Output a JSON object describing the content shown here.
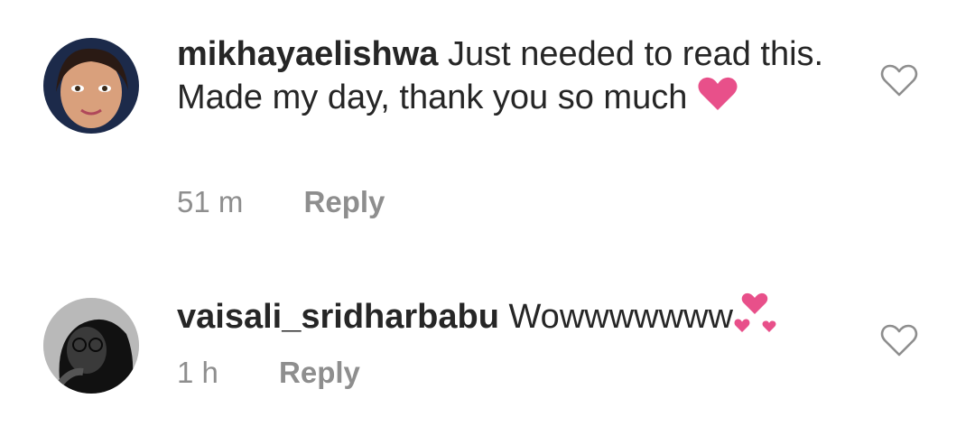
{
  "comments": [
    {
      "username": "mikhayaelishwa",
      "text": "Just needed to read this. Made my day, thank you so much",
      "emoji": "heart-icon",
      "time": "51 m",
      "reply_label": "Reply"
    },
    {
      "username": "vaisali_sridharbabu",
      "text": "Wowwwwwww",
      "emoji": "revolving-hearts-icon",
      "time": "1 h",
      "reply_label": "Reply"
    }
  ],
  "colors": {
    "text": "#262626",
    "muted": "#8e8e8e",
    "heart_emoji": "#e8508a",
    "like_outline": "#8e8e8e"
  }
}
